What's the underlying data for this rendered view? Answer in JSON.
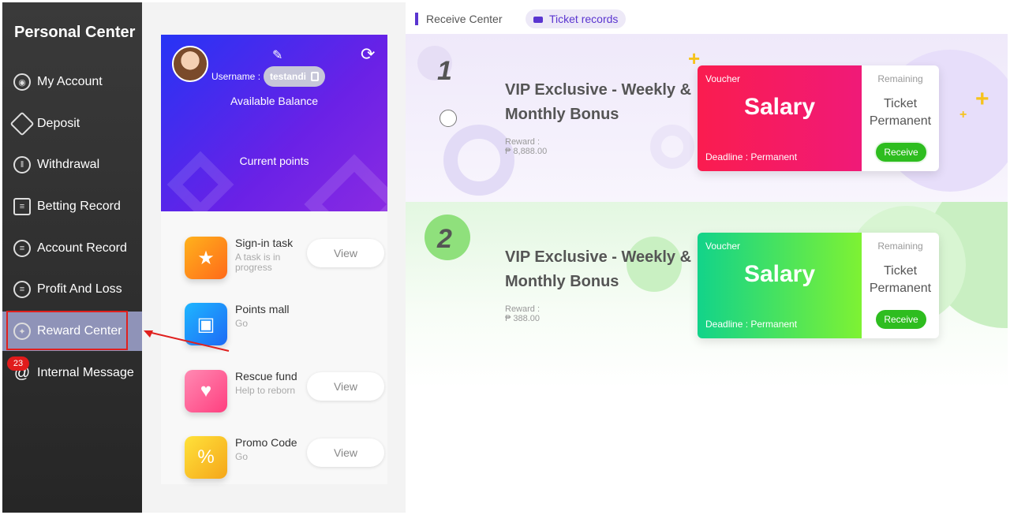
{
  "sidebar": {
    "title": "Personal Center",
    "items": [
      {
        "label": "My Account"
      },
      {
        "label": "Deposit"
      },
      {
        "label": "Withdrawal"
      },
      {
        "label": "Betting Record"
      },
      {
        "label": "Account Record"
      },
      {
        "label": "Profit And Loss"
      },
      {
        "label": "Reward Center"
      },
      {
        "label": "Internal Message"
      }
    ],
    "message_badge": "23"
  },
  "profile": {
    "username_label": "Username :",
    "username": "testandi",
    "available_balance_label": "Available Balance",
    "current_points_label": "Current points"
  },
  "tasks": [
    {
      "title": "Sign-in task",
      "subtitle": "A task is in progress",
      "button": "View"
    },
    {
      "title": "Points mall",
      "subtitle": "Go",
      "button": ""
    },
    {
      "title": "Rescue fund",
      "subtitle": "Help to reborn",
      "button": "View"
    },
    {
      "title": "Promo Code",
      "subtitle": "Go",
      "button": "View"
    }
  ],
  "tabs": {
    "receive_center": "Receive Center",
    "ticket_records": "Ticket records"
  },
  "rewards": [
    {
      "rank": "1",
      "title": "VIP Exclusive - Weekly & Monthly Bonus",
      "reward_label": "Reward :",
      "reward_value": "₱  8,888.00",
      "voucher_label": "Voucher",
      "voucher_title": "Salary",
      "deadline": "Deadline : Permanent",
      "remaining_label": "Remaining",
      "ticket_text": "Ticket Permanent",
      "button": "Receive"
    },
    {
      "rank": "2",
      "title": "VIP Exclusive - Weekly & Monthly Bonus",
      "reward_label": "Reward :",
      "reward_value": "₱  388.00",
      "voucher_label": "Voucher",
      "voucher_title": "Salary",
      "deadline": "Deadline : Permanent",
      "remaining_label": "Remaining",
      "ticket_text": "Ticket Permanent",
      "button": "Receive"
    }
  ],
  "colors": {
    "sidebar_bg": "#2e2e2e",
    "active_item": "#8f93b8",
    "highlight_red": "#e0201e",
    "accent_purple": "#5a35d0",
    "voucher_pink": "#fa1c4f",
    "voucher_green": "#12d38a",
    "receive_green": "#2ebd1f"
  },
  "icons": [
    "account-icon",
    "deposit-icon",
    "withdrawal-icon",
    "betting-record-icon",
    "account-record-icon",
    "profit-loss-icon",
    "reward-center-icon",
    "at-sign-icon",
    "edit-icon",
    "refresh-icon",
    "copy-icon",
    "ticket-icon"
  ]
}
